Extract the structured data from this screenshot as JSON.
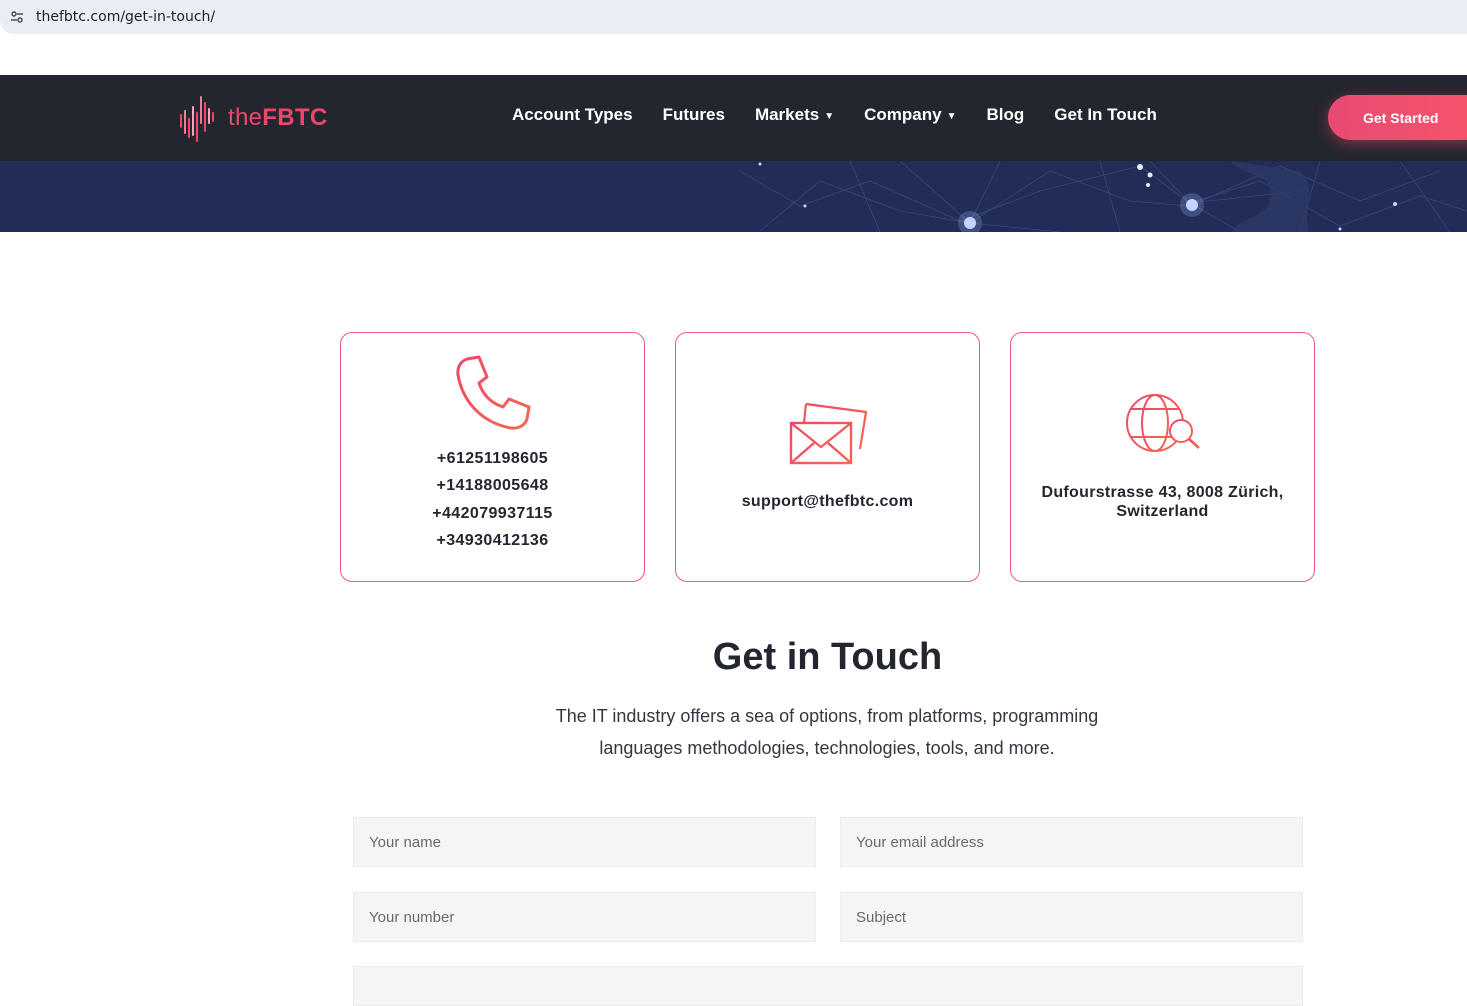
{
  "browser": {
    "url": "thefbtc.com/get-in-touch/"
  },
  "brand": {
    "logo_prefix": "the",
    "logo_strong": "FBTC",
    "accent": "#f0466b"
  },
  "nav": {
    "items": [
      {
        "label": "Account Types",
        "has_dropdown": false
      },
      {
        "label": "Futures",
        "has_dropdown": false
      },
      {
        "label": "Markets",
        "has_dropdown": true
      },
      {
        "label": "Company",
        "has_dropdown": true
      },
      {
        "label": "Blog",
        "has_dropdown": false
      },
      {
        "label": "Get In Touch",
        "has_dropdown": false
      }
    ],
    "cta_label": "Get Started",
    "caret": "⌄"
  },
  "contact": {
    "phones": [
      "+61251198605",
      "+14188005648",
      "+442079937115",
      "+34930412136"
    ],
    "email": "support@thefbtc.com",
    "address": "Dufourstrasse 43, 8008 Zürich, Switzerland"
  },
  "section": {
    "title": "Get in Touch",
    "description": "The IT industry offers a sea of options, from platforms, programming languages methodologies, technologies, tools, and more."
  },
  "form": {
    "name_placeholder": "Your name",
    "email_placeholder": "Your email address",
    "number_placeholder": "Your number",
    "subject_placeholder": "Subject"
  }
}
